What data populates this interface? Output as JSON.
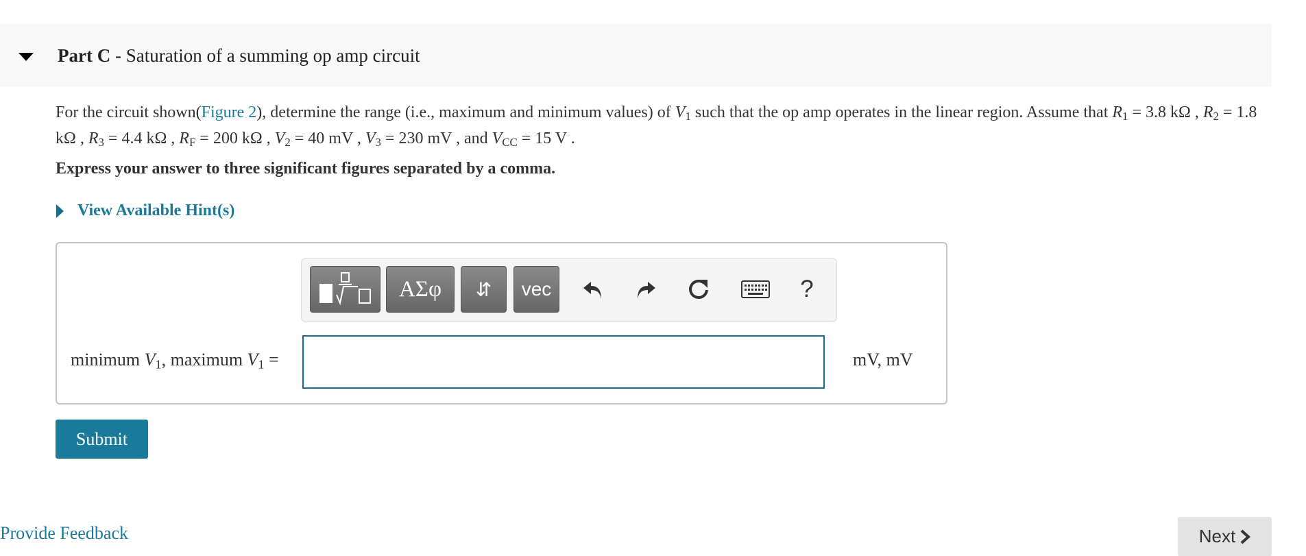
{
  "part": {
    "label": "Part C",
    "separator": " - ",
    "title": "Saturation of a summing op amp circuit"
  },
  "problem": {
    "t1": "For the circuit shown(",
    "figure_link": "Figure 2",
    "t2": "), determine the range (i.e., maximum and minimum values) of ",
    "v": "V",
    "v1_sub": "1",
    "t3": " such that the op amp operates in the linear region. Assume that ",
    "r": "R",
    "r1_sub": "1",
    "eq1": " = 3.8 kΩ , ",
    "r2_sub": "2",
    "eq2": " = 1.8 kΩ , ",
    "r3_sub": "3",
    "eq3": " = 4.4 kΩ , ",
    "rf_sub": "F",
    "eq4": " = 200 kΩ , ",
    "v2_sub": "2",
    "eq5": " = 40 mV , ",
    "v3_sub": "3",
    "eq6": " = 230 mV , and ",
    "vcc_sub": "CC",
    "eq7": " = 15 V ."
  },
  "instruction": "Express your answer to three significant figures separated by a comma.",
  "hint_link": "View Available Hint(s)",
  "toolbar": {
    "greek": "ΑΣφ",
    "arrows": "⇵",
    "vec": "vec",
    "help": "?"
  },
  "answer": {
    "label_min": "minimum ",
    "var": "V",
    "sub": "1",
    "label_sep": ", maximum ",
    "label_eq": " =",
    "value": "",
    "unit": "mV, mV"
  },
  "submit_label": "Submit",
  "feedback_link": "Provide Feedback",
  "next_label": "Next",
  "colors": {
    "link": "#1b7a99",
    "submit_bg": "#1a7a9b",
    "toolbar_btn": "#777777",
    "next_bg": "#e3e3e3"
  }
}
